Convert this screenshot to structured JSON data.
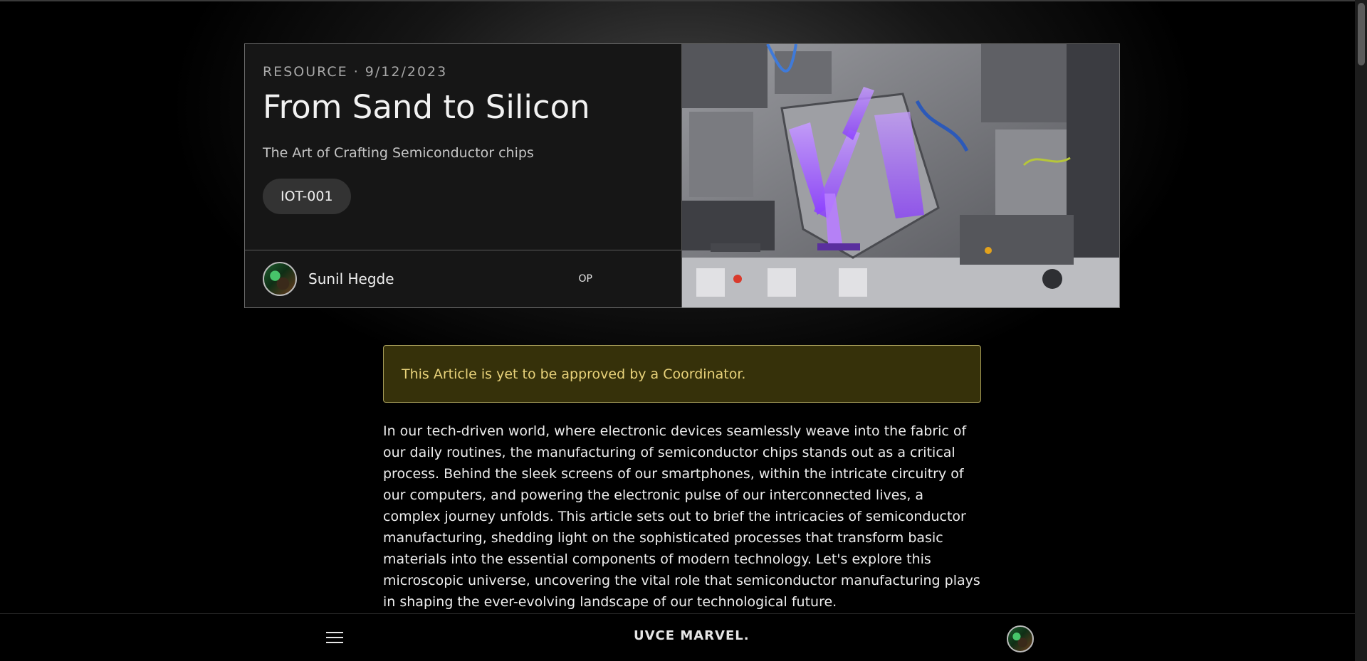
{
  "hero": {
    "category": "RESOURCE",
    "separator": "·",
    "date": "9/12/2023",
    "title": "From Sand to Silicon",
    "subtitle": "The Art of Crafting Semiconductor chips",
    "tag": "IOT-001",
    "author": "Sunil Hegde",
    "author_role": "OP"
  },
  "notice": {
    "text": "This Article is yet to be approved by a Coordinator."
  },
  "article": {
    "paragraph": "In our tech-driven world, where electronic devices seamlessly weave into the fabric of our daily routines, the manufacturing of semiconductor chips stands out as a critical process. Behind the sleek screens of our smartphones, within the intricate circuitry of our computers, and powering the electronic pulse of our interconnected lives, a complex journey unfolds. This article sets out to brief the intricacies of semiconductor manufacturing, shedding light on the sophisticated processes that transform basic materials into the essential components of modern technology. Let's explore this microscopic universe, uncovering the vital role that semiconductor manufacturing plays in shaping the ever-evolving landscape of our technological future."
  },
  "nav": {
    "brand": "UVCE MARVEL."
  },
  "icons": {
    "menu": "hamburger-menu-icon",
    "avatar": "user-avatar"
  },
  "colors": {
    "notice_bg": "#36310a",
    "notice_text": "#e8d27a",
    "accent_purple": "#a56cff"
  }
}
